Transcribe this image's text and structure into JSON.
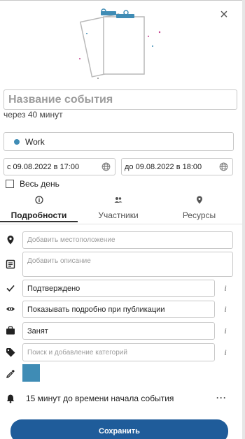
{
  "close_icon": "close-icon",
  "illustration_icon": "clipboard-notes-illustration",
  "event": {
    "title_placeholder": "Название события",
    "time_hint": "через 40 минут"
  },
  "calendar": {
    "name": "Work",
    "color": "#3f8cb5"
  },
  "dates": {
    "start": "с 09.08.2022 в 17:00",
    "end": "до 09.08.2022 в 18:00"
  },
  "all_day": {
    "label": "Весь день",
    "checked": false
  },
  "tabs": [
    {
      "label": "Подробности",
      "icon": "info-icon",
      "active": true
    },
    {
      "label": "Участники",
      "icon": "people-icon",
      "active": false
    },
    {
      "label": "Ресурсы",
      "icon": "location-pin-icon",
      "active": false
    }
  ],
  "details": {
    "location_placeholder": "Добавить местоположение",
    "description_placeholder": "Добавить описание",
    "status": "Подтверждено",
    "visibility": "Показывать подробно при публикации",
    "busy": "Занят",
    "categories_placeholder": "Поиск и добавление категорий",
    "info_label": "i",
    "event_color": "#3f8cb5"
  },
  "reminder": {
    "text": "15 минут до времени начала события",
    "more_label": "···"
  },
  "save_label": "Сохранить",
  "colors": {
    "primary_button": "#1f5c9a",
    "accent": "#3f8cb5"
  }
}
